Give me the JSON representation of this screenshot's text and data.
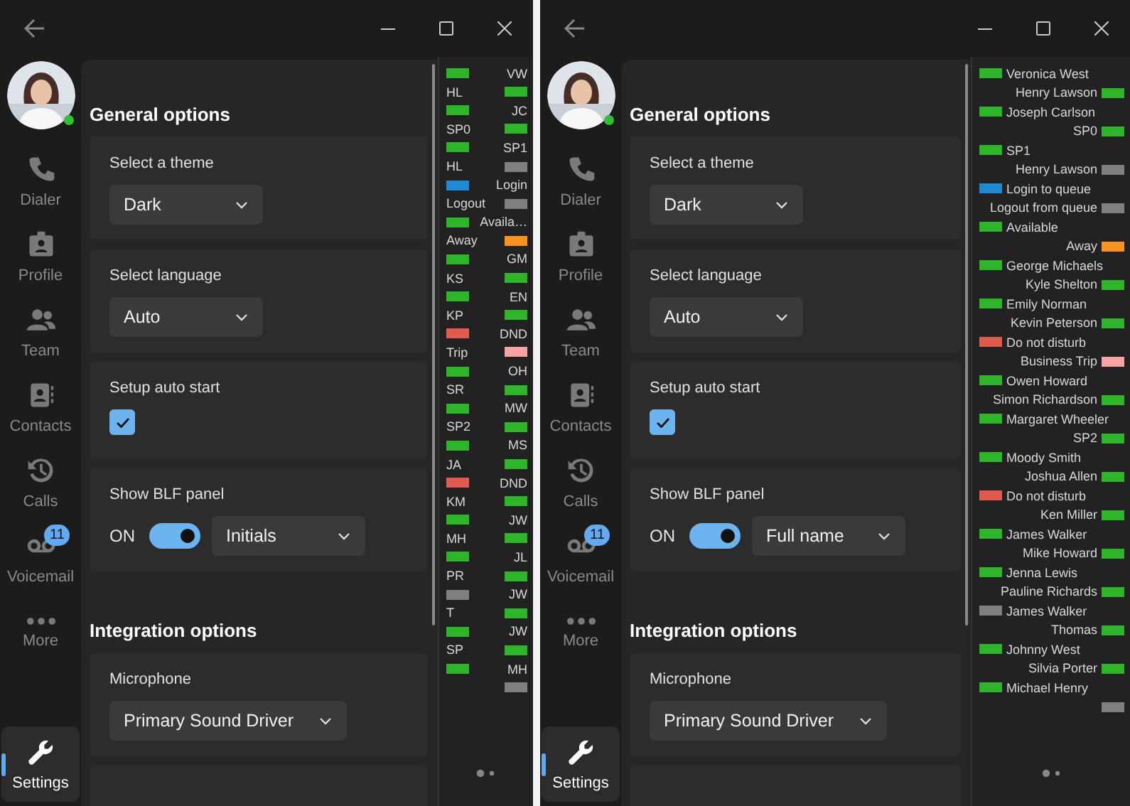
{
  "windows": [
    {
      "user": {
        "online": true
      },
      "nav": [
        {
          "kind": "dialer",
          "label": "Dialer",
          "selected": false
        },
        {
          "kind": "profile",
          "label": "Profile",
          "selected": false
        },
        {
          "kind": "team",
          "label": "Team",
          "selected": false
        },
        {
          "kind": "contacts",
          "label": "Contacts",
          "selected": false
        },
        {
          "kind": "calls",
          "label": "Calls",
          "selected": false
        },
        {
          "kind": "voicemail",
          "label": "Voicemail",
          "selected": false,
          "badge": "11"
        },
        {
          "kind": "more",
          "label": "More",
          "selected": false
        },
        {
          "kind": "settings",
          "label": "Settings",
          "selected": true
        }
      ],
      "sections": [
        {
          "heading": "General options",
          "cards": [
            {
              "kind": "dropdown",
              "label": "Select a theme",
              "value": "Dark"
            },
            {
              "kind": "dropdown",
              "label": "Select language",
              "value": "Auto"
            },
            {
              "kind": "checkbox",
              "label": "Setup auto start",
              "checked": true
            },
            {
              "kind": "toggle",
              "label": "Show BLF panel",
              "state_label": "ON",
              "on": true,
              "value": "Initials"
            }
          ]
        },
        {
          "heading": "Integration options",
          "cards": [
            {
              "kind": "dropdown",
              "label": "Microphone",
              "value": "Primary Sound Driver"
            }
          ]
        }
      ],
      "blf": [
        {
          "label": "VW",
          "color": "#2fb52a"
        },
        {
          "label": "HL",
          "color": "#2fb52a"
        },
        {
          "label": "JC",
          "color": "#2fb52a"
        },
        {
          "label": "SP0",
          "color": "#2fb52a"
        },
        {
          "label": "SP1",
          "color": "#2fb52a"
        },
        {
          "label": "HL",
          "color": "#808080"
        },
        {
          "label": "Login",
          "color": "#1e8ad3"
        },
        {
          "label": "Logout",
          "color": "#808080"
        },
        {
          "label": "Availa…",
          "color": "#2fb52a"
        },
        {
          "label": "Away",
          "color": "#f7931e"
        },
        {
          "label": "GM",
          "color": "#2fb52a"
        },
        {
          "label": "KS",
          "color": "#2fb52a"
        },
        {
          "label": "EN",
          "color": "#2fb52a"
        },
        {
          "label": "KP",
          "color": "#2fb52a"
        },
        {
          "label": "DND",
          "color": "#e05a4e"
        },
        {
          "label": "Trip",
          "color": "#f5a3a3"
        },
        {
          "label": "OH",
          "color": "#2fb52a"
        },
        {
          "label": "SR",
          "color": "#2fb52a"
        },
        {
          "label": "MW",
          "color": "#2fb52a"
        },
        {
          "label": "SP2",
          "color": "#2fb52a"
        },
        {
          "label": "MS",
          "color": "#2fb52a"
        },
        {
          "label": "JA",
          "color": "#2fb52a"
        },
        {
          "label": "DND",
          "color": "#e05a4e"
        },
        {
          "label": "KM",
          "color": "#2fb52a"
        },
        {
          "label": "JW",
          "color": "#2fb52a"
        },
        {
          "label": "MH",
          "color": "#2fb52a"
        },
        {
          "label": "JL",
          "color": "#2fb52a"
        },
        {
          "label": "PR",
          "color": "#2fb52a"
        },
        {
          "label": "JW",
          "color": "#808080"
        },
        {
          "label": "T",
          "color": "#2fb52a"
        },
        {
          "label": "JW",
          "color": "#2fb52a"
        },
        {
          "label": "SP",
          "color": "#2fb52a"
        },
        {
          "label": "MH",
          "color": "#2fb52a"
        },
        {
          "color": "#808080"
        }
      ]
    },
    {
      "user": {
        "online": true
      },
      "nav": [
        {
          "kind": "dialer",
          "label": "Dialer",
          "selected": false
        },
        {
          "kind": "profile",
          "label": "Profile",
          "selected": false
        },
        {
          "kind": "team",
          "label": "Team",
          "selected": false
        },
        {
          "kind": "contacts",
          "label": "Contacts",
          "selected": false
        },
        {
          "kind": "calls",
          "label": "Calls",
          "selected": false
        },
        {
          "kind": "voicemail",
          "label": "Voicemail",
          "selected": false,
          "badge": "11"
        },
        {
          "kind": "more",
          "label": "More",
          "selected": false
        },
        {
          "kind": "settings",
          "label": "Settings",
          "selected": true
        }
      ],
      "sections": [
        {
          "heading": "General options",
          "cards": [
            {
              "kind": "dropdown",
              "label": "Select a theme",
              "value": "Dark"
            },
            {
              "kind": "dropdown",
              "label": "Select language",
              "value": "Auto"
            },
            {
              "kind": "checkbox",
              "label": "Setup auto start",
              "checked": true
            },
            {
              "kind": "toggle",
              "label": "Show BLF panel",
              "state_label": "ON",
              "on": true,
              "value": "Full name"
            }
          ]
        },
        {
          "heading": "Integration options",
          "cards": [
            {
              "kind": "dropdown",
              "label": "Microphone",
              "value": "Primary Sound Driver"
            }
          ]
        }
      ],
      "blf": [
        {
          "label": "Veronica West",
          "color": "#2fb52a"
        },
        {
          "label": "Henry Lawson",
          "color": "#2fb52a"
        },
        {
          "label": "Joseph Carlson",
          "color": "#2fb52a"
        },
        {
          "label": "SP0",
          "color": "#2fb52a"
        },
        {
          "label": "SP1",
          "color": "#2fb52a"
        },
        {
          "label": "Henry Lawson",
          "color": "#808080"
        },
        {
          "label": "Login to queue",
          "color": "#1e8ad3"
        },
        {
          "label": "Logout from queue",
          "color": "#808080"
        },
        {
          "label": "Available",
          "color": "#2fb52a"
        },
        {
          "label": "Away",
          "color": "#f7931e"
        },
        {
          "label": "George Michaels",
          "color": "#2fb52a"
        },
        {
          "label": "Kyle Shelton",
          "color": "#2fb52a"
        },
        {
          "label": "Emily Norman",
          "color": "#2fb52a"
        },
        {
          "label": "Kevin Peterson",
          "color": "#2fb52a"
        },
        {
          "label": "Do not disturb",
          "color": "#e05a4e"
        },
        {
          "label": "Business Trip",
          "color": "#f5a3a3"
        },
        {
          "label": "Owen Howard",
          "color": "#2fb52a"
        },
        {
          "label": "Simon Richardson",
          "color": "#2fb52a"
        },
        {
          "label": "Margaret Wheeler",
          "color": "#2fb52a"
        },
        {
          "label": "SP2",
          "color": "#2fb52a"
        },
        {
          "label": "Moody Smith",
          "color": "#2fb52a"
        },
        {
          "label": "Joshua Allen",
          "color": "#2fb52a"
        },
        {
          "label": "Do not disturb",
          "color": "#e05a4e"
        },
        {
          "label": "Ken Miller",
          "color": "#2fb52a"
        },
        {
          "label": "James Walker",
          "color": "#2fb52a"
        },
        {
          "label": "Mike Howard",
          "color": "#2fb52a"
        },
        {
          "label": "Jenna Lewis",
          "color": "#2fb52a"
        },
        {
          "label": "Pauline Richards",
          "color": "#2fb52a"
        },
        {
          "label": "James Walker",
          "color": "#808080"
        },
        {
          "label": "Thomas",
          "color": "#2fb52a"
        },
        {
          "label": "Johnny West",
          "color": "#2fb52a"
        },
        {
          "label": "Silvia Porter",
          "color": "#2fb52a"
        },
        {
          "label": "Michael Henry",
          "color": "#2fb52a"
        },
        {
          "color": "#808080"
        }
      ]
    }
  ]
}
